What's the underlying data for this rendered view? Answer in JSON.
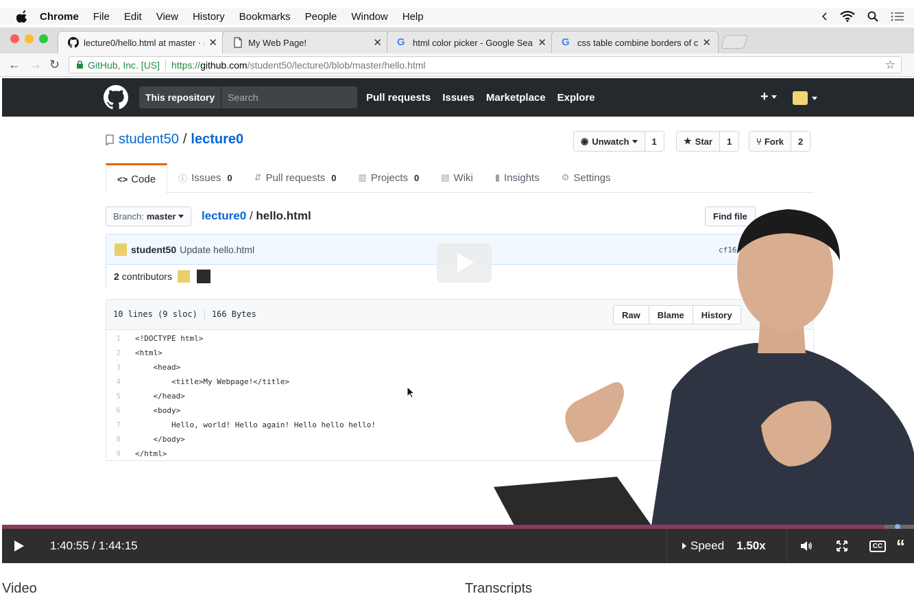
{
  "menubar": {
    "app": "Chrome",
    "items": [
      "File",
      "Edit",
      "View",
      "History",
      "Bookmarks",
      "People",
      "Window",
      "Help"
    ]
  },
  "tabs": [
    {
      "label": "lecture0/hello.html at master · s",
      "icon": "github-icon",
      "active": true
    },
    {
      "label": "My Web Page!",
      "icon": "page-icon",
      "active": false
    },
    {
      "label": "html color picker - Google Sea",
      "icon": "google-icon",
      "active": false
    },
    {
      "label": "css table combine borders of c",
      "icon": "google-icon",
      "active": false
    }
  ],
  "address": {
    "secure_label": "GitHub, Inc. [US]",
    "scheme": "https://",
    "host": "github.com",
    "path": "/student50/lecture0/blob/master/hello.html"
  },
  "github_header": {
    "scope": "This repository",
    "search_placeholder": "Search",
    "nav": [
      "Pull requests",
      "Issues",
      "Marketplace",
      "Explore"
    ],
    "plus": "+"
  },
  "repo": {
    "owner": "student50",
    "name": "lecture0",
    "watch_label": "Unwatch",
    "watch_count": "1",
    "star_label": "Star",
    "star_count": "1",
    "fork_label": "Fork",
    "fork_count": "2"
  },
  "repo_tabs": [
    {
      "label": "Code",
      "count": ""
    },
    {
      "label": "Issues",
      "count": "0"
    },
    {
      "label": "Pull requests",
      "count": "0"
    },
    {
      "label": "Projects",
      "count": "0"
    },
    {
      "label": "Wiki",
      "count": ""
    },
    {
      "label": "Insights",
      "count": ""
    },
    {
      "label": "Settings",
      "count": ""
    }
  ],
  "file": {
    "branch_prefix": "Branch:",
    "branch": "master",
    "path_repo": "lecture0",
    "path_file": "hello.html",
    "find_file": "Find file",
    "commit_author": "student50",
    "commit_message": "Update hello.html",
    "commit_sha": "cf16",
    "contributors_count": "2",
    "contributors_label": "contributors",
    "lines_info": "10 lines (9 sloc)",
    "size_info": "166 Bytes",
    "buttons": [
      "Raw",
      "Blame",
      "History"
    ]
  },
  "code_lines": [
    "<!DOCTYPE html>",
    "<html>",
    "    <head>",
    "        <title>My Webpage!</title>",
    "    </head>",
    "    <body>",
    "        Hello, world! Hello again! Hello hello hello!",
    "    </body>",
    "</html>"
  ],
  "player": {
    "time": "1:40:55 / 1:44:15",
    "progress": 0.968,
    "speed_label": "Speed",
    "speed_value": "1.50x",
    "cc": "CC"
  },
  "below": {
    "video_heading": "Video",
    "transcripts_heading": "Transcripts"
  },
  "colors": {
    "accent_orange": "#e36209",
    "link_blue": "#0366d6",
    "progress_fill": "#8b3a62",
    "github_dark": "#24292e"
  }
}
